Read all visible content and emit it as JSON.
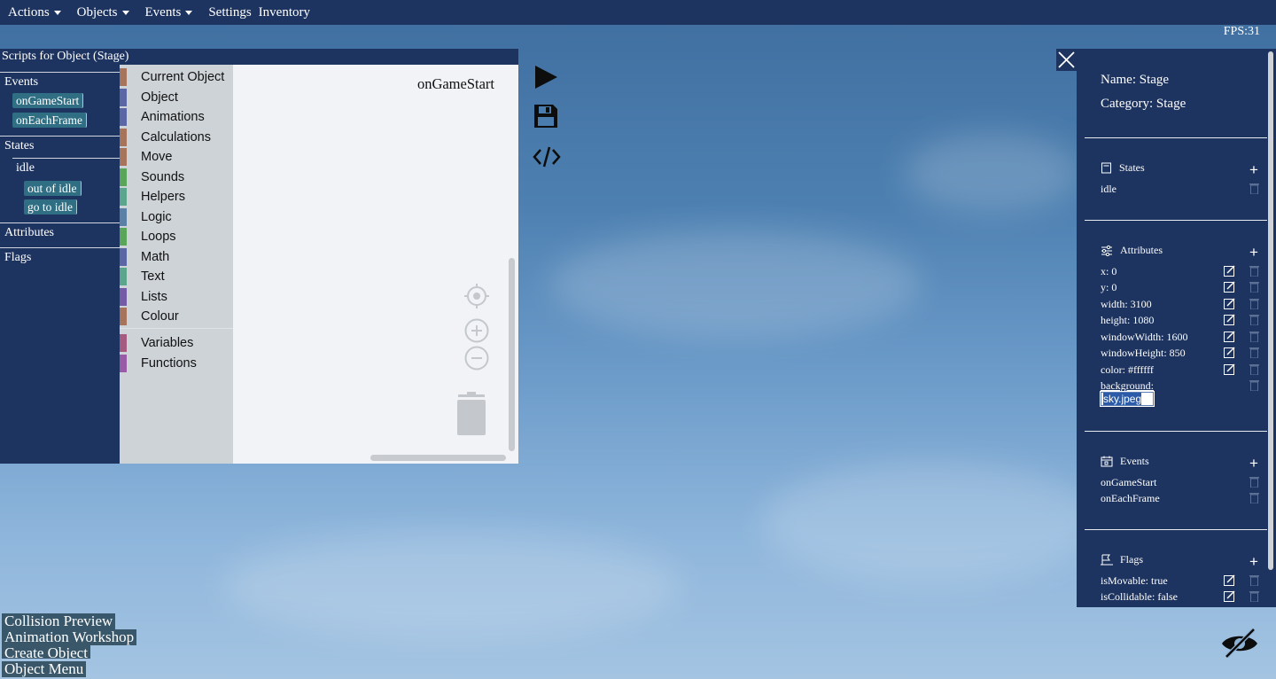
{
  "menubar": {
    "items": [
      {
        "label": "Actions",
        "has_caret": true
      },
      {
        "label": "Objects",
        "has_caret": true
      },
      {
        "label": "Events",
        "has_caret": true
      },
      {
        "label": "Settings",
        "has_caret": false
      },
      {
        "label": "Inventory",
        "has_caret": false
      }
    ]
  },
  "fps": "FPS:31",
  "scripts_panel": {
    "title": "Scripts for Object (Stage)",
    "sidebar": {
      "events_heading": "Events",
      "events": [
        "onGameStart",
        "onEachFrame"
      ],
      "states_heading": "States",
      "state_name": "idle",
      "state_events": [
        "out of idle",
        "go to idle"
      ],
      "attributes_heading": "Attributes",
      "flags_heading": "Flags"
    },
    "toolbox": {
      "categories": [
        {
          "label": "Current Object",
          "color": "#a5745b"
        },
        {
          "label": "Object",
          "color": "#5b67a5"
        },
        {
          "label": "Animations",
          "color": "#5b67a5"
        },
        {
          "label": "Calculations",
          "color": "#a5745b"
        },
        {
          "label": "Move",
          "color": "#a5745b"
        },
        {
          "label": "Sounds",
          "color": "#5ba55b"
        },
        {
          "label": "Helpers",
          "color": "#5ba58c"
        },
        {
          "label": "Logic",
          "color": "#5b80a5"
        },
        {
          "label": "Loops",
          "color": "#5ba55b"
        },
        {
          "label": "Math",
          "color": "#5b67a5"
        },
        {
          "label": "Text",
          "color": "#5ba58c"
        },
        {
          "label": "Lists",
          "color": "#745ba5"
        },
        {
          "label": "Colour",
          "color": "#a5745b"
        },
        {
          "label": "Variables",
          "color": "#a55b80"
        },
        {
          "label": "Functions",
          "color": "#995ba5"
        }
      ]
    },
    "workspace": {
      "label": "onGameStart"
    }
  },
  "properties": {
    "name_line": "Name: Stage",
    "category_line": "Category: Stage",
    "states": {
      "heading": "States",
      "items": [
        "idle"
      ]
    },
    "attributes": {
      "heading": "Attributes",
      "items": [
        "x: 0",
        "y: 0",
        "width: 3100",
        "height: 1080",
        "windowWidth: 1600",
        "windowHeight: 850",
        "color: #ffffff"
      ],
      "background_label": "background:",
      "background_value": "sky.jpeg"
    },
    "events": {
      "heading": "Events",
      "items": [
        "onGameStart",
        "onEachFrame"
      ]
    },
    "flags": {
      "heading": "Flags",
      "items": [
        "isMovable: true",
        "isCollidable: false"
      ]
    }
  },
  "bottom_buttons": [
    "Collision Preview",
    "Animation Workshop",
    "Create Object",
    "Object Menu"
  ],
  "icons": {
    "play": "play-icon",
    "save": "save-icon",
    "code": "code-icon",
    "close": "close-icon",
    "hide": "eye-slash-icon"
  }
}
